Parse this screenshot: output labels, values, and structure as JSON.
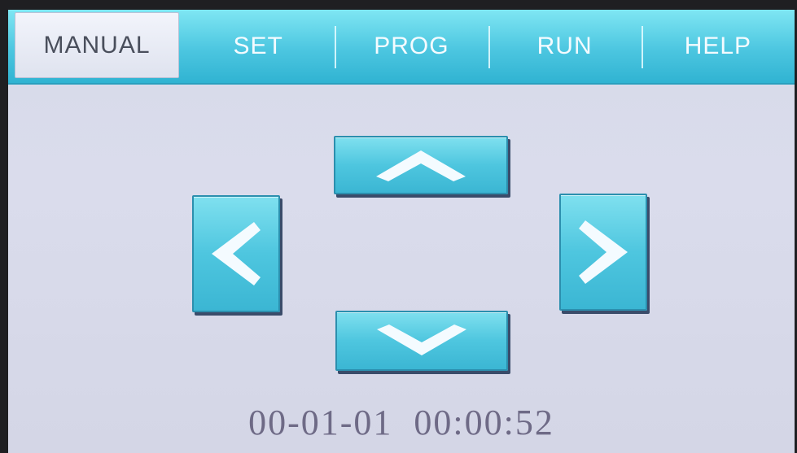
{
  "tabs": [
    {
      "label": "MANUAL",
      "active": true
    },
    {
      "label": "SET"
    },
    {
      "label": "PROG"
    },
    {
      "label": "RUN"
    },
    {
      "label": "HELP"
    }
  ],
  "dpad": {
    "up_icon": "chevron-up-icon",
    "down_icon": "chevron-down-icon",
    "left_icon": "chevron-left-icon",
    "right_icon": "chevron-right-icon"
  },
  "status": {
    "date": "00-01-01",
    "time": "00:00:52"
  },
  "colors": {
    "tab_bar": "#4cc6e0",
    "button": "#4ec6df",
    "active_tab": "#eceff7",
    "background": "#d8dbea",
    "datetime_text": "#6e6a86"
  }
}
